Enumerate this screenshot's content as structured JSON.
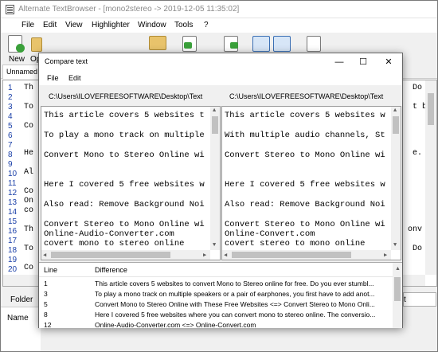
{
  "main_window": {
    "title": "Alternate TextBrowser - [mono2stereo -> 2019-12-05 11:35:02]",
    "menu": [
      "File",
      "Edit",
      "View",
      "Highlighter",
      "Window",
      "Tools",
      "?"
    ],
    "toolbar": {
      "new_label": "New",
      "open_label": "Op"
    },
    "tab_label": "Unnamed",
    "line_numbers": [
      "1",
      "2",
      "3",
      "4",
      "5",
      "6",
      "7",
      "8",
      "9",
      "10",
      "11",
      "12",
      "13",
      "14",
      "15",
      "16",
      "17",
      "18",
      "19",
      "20",
      "21"
    ],
    "left_fragments": [
      "Th",
      "To",
      "Co",
      "He",
      "Al",
      "Co",
      "On",
      "co",
      "Th",
      "To",
      "Co"
    ],
    "right_fragments": [
      "Do",
      "t b",
      "e.",
      "onv",
      "Do"
    ],
    "bottom": {
      "folder_label": "Folder",
      "name_label": "Name",
      "button_fragment": "t"
    }
  },
  "dialog": {
    "title": "Compare text",
    "menu": [
      "File",
      "Edit"
    ],
    "left_path": "C:\\Users\\ILOVEFREESOFTWARE\\Desktop\\Text",
    "right_path": "C:\\Users\\ILOVEFREESOFTWARE\\Desktop\\Text",
    "left_lines": [
      "This article covers 5 websites t",
      "To play a mono track on multiple",
      "Convert Mono to Stereo Online wi",
      "Here I covered 5 free websites w",
      "Also read: Remove Background Noi",
      "Convert Stereo to Mono Online wi",
      "Online-Audio-Converter.com",
      "covert mono to stereo online"
    ],
    "right_lines": [
      "This article covers 5 websites w",
      "With multiple audio channels, St",
      "Convert Stereo to Mono Online wi",
      "Here I covered 5 free websites w",
      "Also read: Remove Background Noi",
      "Convert Stereo to Mono Online wi",
      "Online-Convert.com",
      "covert stereo to mono online"
    ],
    "diff_headers": {
      "line": "Line",
      "difference": "Difference"
    },
    "diff_rows": [
      {
        "line": "1",
        "difference": "This article covers 5 websites to convert Mono to Stereo online for free. Do you ever stumbl..."
      },
      {
        "line": "3",
        "difference": "To play a mono track on multiple speakers or a pair of earphones, you first have to add anot..."
      },
      {
        "line": "5",
        "difference": "Convert Mono to Stereo Online with These Free Websites <=> Convert Stereo to Mono Onli..."
      },
      {
        "line": "8",
        "difference": "Here I covered 5 free websites where you can convert mono to stereo online. The conversio..."
      },
      {
        "line": "12",
        "difference": "Online-Audio-Converter.com <=> Online-Convert.com"
      }
    ]
  }
}
